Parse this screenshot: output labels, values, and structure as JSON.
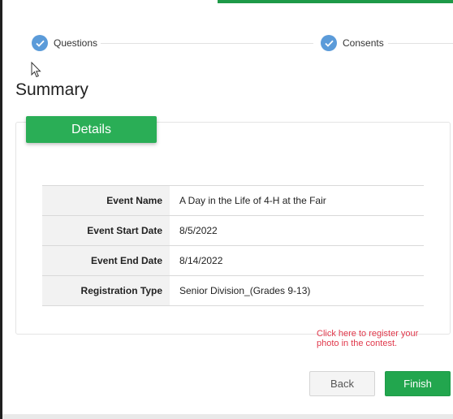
{
  "stepper": {
    "steps": [
      {
        "label": "Questions",
        "state": "complete"
      },
      {
        "label": "Consents",
        "state": "complete"
      }
    ],
    "complete_color": "#5b9bd9"
  },
  "page": {
    "title": "Summary"
  },
  "details": {
    "tab_label": "Details",
    "rows": [
      {
        "key": "Event Name",
        "value": "A Day in the Life of 4-H at the Fair"
      },
      {
        "key": "Event Start Date",
        "value": "8/5/2022"
      },
      {
        "key": "Event End Date",
        "value": "8/14/2022"
      },
      {
        "key": "Registration Type",
        "value": "Senior Division_(Grades 9-13)"
      }
    ]
  },
  "note": {
    "text": "Click here to register your photo in the contest."
  },
  "actions": {
    "back_label": "Back",
    "finish_label": "Finish"
  },
  "colors": {
    "accent_green": "#22a64e",
    "note_red": "#e0384b"
  }
}
